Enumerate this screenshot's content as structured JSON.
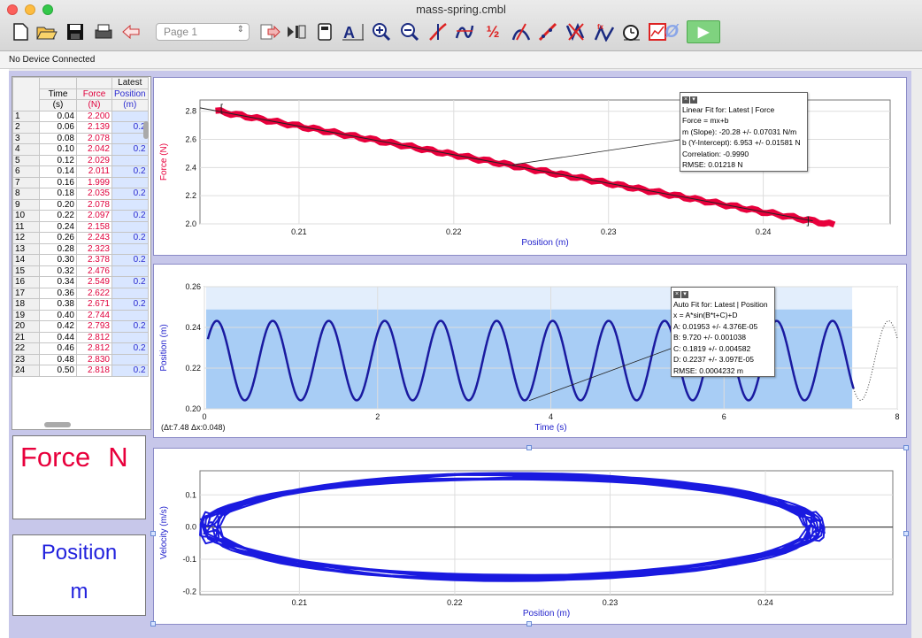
{
  "window": {
    "title": "mass-spring.cmbl"
  },
  "toolbar": {
    "page_select": "Page 1",
    "fx_label": "ƒ",
    "integral_label": "½",
    "zero_label": "Ø",
    "play_label": "▶"
  },
  "status": {
    "device": "No Device Connected"
  },
  "table": {
    "group_header": "Latest",
    "columns": [
      {
        "name": "Time",
        "unit": "(s)"
      },
      {
        "name": "Force",
        "unit": "(N)"
      },
      {
        "name": "Position",
        "unit": "(m)"
      }
    ],
    "rows": [
      {
        "n": "1",
        "t": "0.04",
        "f": "2.200",
        "p": ""
      },
      {
        "n": "2",
        "t": "0.06",
        "f": "2.139",
        "p": "0.2"
      },
      {
        "n": "3",
        "t": "0.08",
        "f": "2.078",
        "p": ""
      },
      {
        "n": "4",
        "t": "0.10",
        "f": "2.042",
        "p": "0.2"
      },
      {
        "n": "5",
        "t": "0.12",
        "f": "2.029",
        "p": ""
      },
      {
        "n": "6",
        "t": "0.14",
        "f": "2.011",
        "p": "0.2"
      },
      {
        "n": "7",
        "t": "0.16",
        "f": "1.999",
        "p": ""
      },
      {
        "n": "8",
        "t": "0.18",
        "f": "2.035",
        "p": "0.2"
      },
      {
        "n": "9",
        "t": "0.20",
        "f": "2.078",
        "p": ""
      },
      {
        "n": "10",
        "t": "0.22",
        "f": "2.097",
        "p": "0.2"
      },
      {
        "n": "11",
        "t": "0.24",
        "f": "2.158",
        "p": ""
      },
      {
        "n": "12",
        "t": "0.26",
        "f": "2.243",
        "p": "0.2"
      },
      {
        "n": "13",
        "t": "0.28",
        "f": "2.323",
        "p": ""
      },
      {
        "n": "14",
        "t": "0.30",
        "f": "2.378",
        "p": "0.2"
      },
      {
        "n": "15",
        "t": "0.32",
        "f": "2.476",
        "p": ""
      },
      {
        "n": "16",
        "t": "0.34",
        "f": "2.549",
        "p": "0.2"
      },
      {
        "n": "17",
        "t": "0.36",
        "f": "2.622",
        "p": ""
      },
      {
        "n": "18",
        "t": "0.38",
        "f": "2.671",
        "p": "0.2"
      },
      {
        "n": "19",
        "t": "0.40",
        "f": "2.744",
        "p": ""
      },
      {
        "n": "20",
        "t": "0.42",
        "f": "2.793",
        "p": "0.2"
      },
      {
        "n": "21",
        "t": "0.44",
        "f": "2.812",
        "p": ""
      },
      {
        "n": "22",
        "t": "0.46",
        "f": "2.812",
        "p": "0.2"
      },
      {
        "n": "23",
        "t": "0.48",
        "f": "2.830",
        "p": ""
      },
      {
        "n": "24",
        "t": "0.50",
        "f": "2.818",
        "p": "0.2"
      }
    ]
  },
  "meters": [
    {
      "name": "Force",
      "unit": "N",
      "color": "#e8003c"
    },
    {
      "name": "Position",
      "unit": "m",
      "color": "#2222dd"
    }
  ],
  "graph1": {
    "xlabel": "Position (m)",
    "ylabel": "Force (N)",
    "x_ticks": [
      "0.21",
      "0.22",
      "0.23",
      "0.24"
    ],
    "y_ticks": [
      "2.0",
      "2.2",
      "2.4",
      "2.6",
      "2.8"
    ],
    "fit": {
      "title": "Linear Fit for: Latest | Force",
      "lines": [
        "Force = mx+b",
        "m (Slope): -20.28 +/- 0.07031 N/m",
        "b (Y-Intercept): 6.953 +/- 0.01581 N",
        "Correlation: -0.9990",
        "RMSE: 0.01218 N"
      ]
    }
  },
  "graph2": {
    "xlabel": "Time (s)",
    "ylabel": "Position (m)",
    "x_ticks": [
      "0",
      "2",
      "4",
      "6",
      "8"
    ],
    "y_ticks": [
      "0.20",
      "0.22",
      "0.24",
      "0.26"
    ],
    "delta": "(Δt:7.48 Δx:0.048)",
    "fit": {
      "title": "Auto Fit for: Latest | Position",
      "lines": [
        "x = A*sin(B*t+C)+D",
        "A: 0.01953 +/- 4.376E-05",
        "B: 9.720 +/- 0.001038",
        "C: 0.1819 +/- 0.004582",
        "D: 0.2237 +/- 3.097E-05",
        "RMSE: 0.0004232 m"
      ]
    }
  },
  "graph3": {
    "xlabel": "Position (m)",
    "ylabel": "Velocity (m/s)",
    "x_ticks": [
      "0.21",
      "0.22",
      "0.23",
      "0.24"
    ],
    "y_ticks": [
      "-0.2",
      "-0.1",
      "0.0",
      "0.1"
    ]
  },
  "colors": {
    "force": "#e8003c",
    "position": "#2222dd",
    "panel_border": "#8b8bc7",
    "fit_region": "#a8cdf5"
  }
}
